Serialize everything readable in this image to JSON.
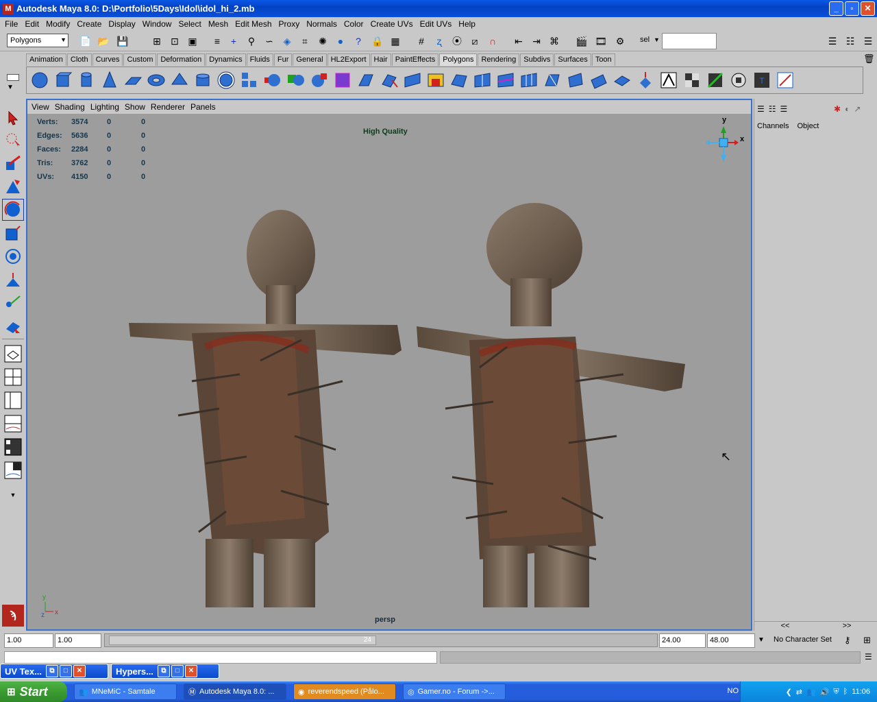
{
  "window": {
    "title": "Autodesk Maya 8.0: D:\\Portfolio\\5Days\\Idol\\idol_hi_2.mb"
  },
  "menu": [
    "File",
    "Edit",
    "Modify",
    "Create",
    "Display",
    "Window",
    "Select",
    "Mesh",
    "Edit Mesh",
    "Proxy",
    "Normals",
    "Color",
    "Create UVs",
    "Edit UVs",
    "Help"
  ],
  "status": {
    "mode": "Polygons",
    "sel_label": "sel",
    "sel_value": ""
  },
  "shelf_tabs": [
    "Animation",
    "Cloth",
    "Curves",
    "Custom",
    "Deformation",
    "Dynamics",
    "Fluids",
    "Fur",
    "General",
    "HL2Export",
    "Hair",
    "PaintEffects",
    "Polygons",
    "Rendering",
    "Subdivs",
    "Surfaces",
    "Toon"
  ],
  "shelf_active": "Polygons",
  "viewport": {
    "menu": [
      "View",
      "Shading",
      "Lighting",
      "Show",
      "Renderer",
      "Panels"
    ],
    "hud": [
      {
        "label": "Verts:",
        "a": "3574",
        "b": "0",
        "c": "0"
      },
      {
        "label": "Edges:",
        "a": "5636",
        "b": "0",
        "c": "0"
      },
      {
        "label": "Faces:",
        "a": "2284",
        "b": "0",
        "c": "0"
      },
      {
        "label": "Tris:",
        "a": "3762",
        "b": "0",
        "c": "0"
      },
      {
        "label": "UVs:",
        "a": "4150",
        "b": "0",
        "c": "0"
      }
    ],
    "quality": "High Quality",
    "camera": "persp",
    "gizmo": {
      "y": "y",
      "x": "x"
    },
    "axis": {
      "y": "y",
      "z": "z",
      "x": "x"
    }
  },
  "channelbox": {
    "tabs": [
      "Channels",
      "Object"
    ],
    "left_arrow": "<<",
    "right_arrow": ">>"
  },
  "timeline": {
    "start": "1.00",
    "current": "1.00",
    "frame_mark": "24",
    "end": "24.00",
    "range_end": "48.00",
    "charset": "No Character Set"
  },
  "minimized": [
    {
      "label": "UV Tex..."
    },
    {
      "label": "Hypers..."
    }
  ],
  "taskbar": {
    "start": "Start",
    "tasks": [
      "MNeMiC - Samtale",
      "Autodesk Maya 8.0: ...",
      "reverendspeed (Pålo...",
      "Gamer.no - Forum ->..."
    ],
    "lang": "NO",
    "clock": "11:06"
  },
  "colors": {
    "viewport_bg": "#9d9d9d",
    "accent": "#3870d0",
    "hud_text": "#14354a"
  }
}
